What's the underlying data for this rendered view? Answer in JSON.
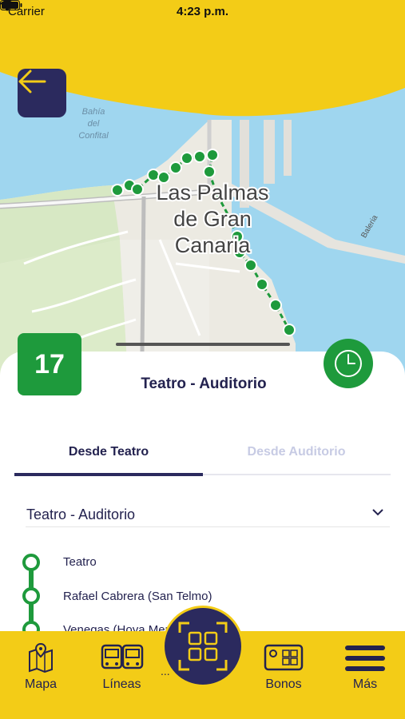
{
  "status_bar": {
    "carrier": "Carrier",
    "time": "4:23 p.m."
  },
  "map": {
    "city_label_line1": "Las Palmas",
    "city_label_line2": "de Gran",
    "city_label_line3": "Canaria",
    "bay_label_line1": "Bahía",
    "bay_label_line2": "del",
    "bay_label_line3": "Confital",
    "street_label": "Baleria"
  },
  "route": {
    "line_number": "17",
    "title": "Teatro - Auditorio"
  },
  "tabs": [
    {
      "label": "Desde Teatro",
      "active": true
    },
    {
      "label": "Desde Auditorio",
      "active": false
    }
  ],
  "route_select": {
    "value": "Teatro - Auditorio"
  },
  "stops": [
    {
      "name": "Teatro"
    },
    {
      "name": "Rafael Cabrera (San Telmo)"
    },
    {
      "name": "Venegas (Hoya Merina)"
    }
  ],
  "tab_bar": {
    "mapa": "Mapa",
    "lineas": "Líneas",
    "bonos": "Bonos",
    "mas": "Más",
    "ticket_fragment": "..."
  },
  "colors": {
    "brand_yellow": "#f3cc17",
    "brand_navy": "#2b2a5e",
    "route_green": "#1e9a3c",
    "text_navy": "#23224f"
  }
}
